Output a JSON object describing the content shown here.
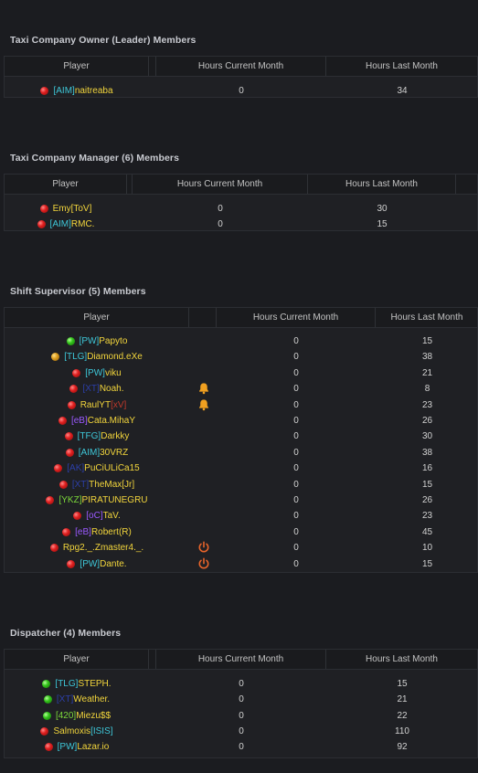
{
  "colors": {
    "background": "#1b1c20",
    "table_bg": "#1f2024",
    "header_bg": "#1a1b1e",
    "name_yellow": "#f2d53c",
    "tag_cyan": "#3ec7d8",
    "tag_purple": "#9b59ff",
    "tag_navy": "#2c3fa8",
    "tag_green": "#7bd63a",
    "tag_red": "#c0392b",
    "bell_orange": "#f0a020",
    "power_orange": "#e8642a"
  },
  "columns": {
    "player": "Player",
    "hours_current": "Hours Current Month",
    "hours_last": "Hours Last Month"
  },
  "sections": [
    {
      "title": "Taxi Company Owner (Leader) Members",
      "members": [
        {
          "status": "red",
          "tag": "[AIM]",
          "tag_color": "#3ec7d8",
          "name": "naitreaba",
          "suffix": "",
          "suffix_color": "",
          "current": "0",
          "last": "34",
          "icon": ""
        }
      ]
    },
    {
      "title": "Taxi Company Manager (6) Members",
      "members": [
        {
          "status": "red",
          "tag": "",
          "tag_color": "",
          "name": "Emy[ToV]",
          "suffix": "",
          "suffix_color": "",
          "current": "0",
          "last": "30",
          "icon": ""
        },
        {
          "status": "red",
          "tag": "[AIM]",
          "tag_color": "#3ec7d8",
          "name": "RMC.",
          "suffix": "",
          "suffix_color": "",
          "current": "0",
          "last": "15",
          "icon": ""
        }
      ]
    },
    {
      "title": "Shift Supervisor (5) Members",
      "members": [
        {
          "status": "green",
          "tag": "[PW]",
          "tag_color": "#3ec7d8",
          "name": "Papyto",
          "suffix": "",
          "suffix_color": "",
          "current": "0",
          "last": "15",
          "icon": ""
        },
        {
          "status": "orange",
          "tag": "[TLG]",
          "tag_color": "#3ec7d8",
          "name": "Diamond.eXe",
          "suffix": "",
          "suffix_color": "",
          "current": "0",
          "last": "38",
          "icon": ""
        },
        {
          "status": "red",
          "tag": "[PW]",
          "tag_color": "#3ec7d8",
          "name": "viku",
          "suffix": "",
          "suffix_color": "",
          "current": "0",
          "last": "21",
          "icon": ""
        },
        {
          "status": "red",
          "tag": "[XT]",
          "tag_color": "#2c3fa8",
          "name": "Noah.",
          "suffix": "",
          "suffix_color": "",
          "current": "0",
          "last": "8",
          "icon": "bell"
        },
        {
          "status": "red",
          "tag": "",
          "tag_color": "",
          "name": "RaulYT",
          "suffix": "[xV]",
          "suffix_color": "#c0392b",
          "current": "0",
          "last": "23",
          "icon": "bell"
        },
        {
          "status": "red",
          "tag": "[eB]",
          "tag_color": "#9b59ff",
          "name": "Cata.MihaY",
          "suffix": "",
          "suffix_color": "",
          "current": "0",
          "last": "26",
          "icon": ""
        },
        {
          "status": "red",
          "tag": "[TFG]",
          "tag_color": "#3ec7d8",
          "name": "Darkky",
          "suffix": "",
          "suffix_color": "",
          "current": "0",
          "last": "30",
          "icon": ""
        },
        {
          "status": "red",
          "tag": "[AIM]",
          "tag_color": "#3ec7d8",
          "name": "30VRZ",
          "suffix": "",
          "suffix_color": "",
          "current": "0",
          "last": "38",
          "icon": ""
        },
        {
          "status": "red",
          "tag": "[AK]",
          "tag_color": "#2c3fa8",
          "name": "PuCiULiCa15",
          "suffix": "",
          "suffix_color": "",
          "current": "0",
          "last": "16",
          "icon": ""
        },
        {
          "status": "red",
          "tag": "[XT]",
          "tag_color": "#2c3fa8",
          "name": "TheMax[Jr]",
          "suffix": "",
          "suffix_color": "",
          "current": "0",
          "last": "15",
          "icon": ""
        },
        {
          "status": "red",
          "tag": "[YKZ]",
          "tag_color": "#7bd63a",
          "name": "PIRATUNEGRU",
          "suffix": "",
          "suffix_color": "",
          "current": "0",
          "last": "26",
          "icon": ""
        },
        {
          "status": "red",
          "tag": "[oC]",
          "tag_color": "#9b59ff",
          "name": "TaV.",
          "suffix": "",
          "suffix_color": "",
          "current": "0",
          "last": "23",
          "icon": ""
        },
        {
          "status": "red",
          "tag": "[eB]",
          "tag_color": "#9b59ff",
          "name": "Robert(R)",
          "suffix": "",
          "suffix_color": "",
          "current": "0",
          "last": "45",
          "icon": ""
        },
        {
          "status": "red",
          "tag": "",
          "tag_color": "",
          "name": "Rpg2._.Zmaster4._.",
          "suffix": "",
          "suffix_color": "",
          "current": "0",
          "last": "10",
          "icon": "power"
        },
        {
          "status": "red",
          "tag": "[PW]",
          "tag_color": "#3ec7d8",
          "name": "Dante.",
          "suffix": "",
          "suffix_color": "",
          "current": "0",
          "last": "15",
          "icon": "power"
        }
      ]
    },
    {
      "title": "Dispatcher (4) Members",
      "members": [
        {
          "status": "green",
          "tag": "[TLG]",
          "tag_color": "#3ec7d8",
          "name": "STEPH.",
          "suffix": "",
          "suffix_color": "",
          "current": "0",
          "last": "15",
          "icon": ""
        },
        {
          "status": "green",
          "tag": "[XT]",
          "tag_color": "#2c3fa8",
          "name": "Weather.",
          "suffix": "",
          "suffix_color": "",
          "current": "0",
          "last": "21",
          "icon": ""
        },
        {
          "status": "green",
          "tag": "[420]",
          "tag_color": "#7bd63a",
          "name": "Miezu$$",
          "suffix": "",
          "suffix_color": "",
          "current": "0",
          "last": "22",
          "icon": ""
        },
        {
          "status": "red",
          "tag": "",
          "tag_color": "",
          "name": "Salmoxis",
          "suffix": "[ISIS]",
          "suffix_color": "#3ec7d8",
          "current": "0",
          "last": "110",
          "icon": ""
        },
        {
          "status": "red",
          "tag": "[PW]",
          "tag_color": "#3ec7d8",
          "name": "Lazar.io",
          "suffix": "",
          "suffix_color": "",
          "current": "0",
          "last": "92",
          "icon": ""
        }
      ]
    }
  ]
}
